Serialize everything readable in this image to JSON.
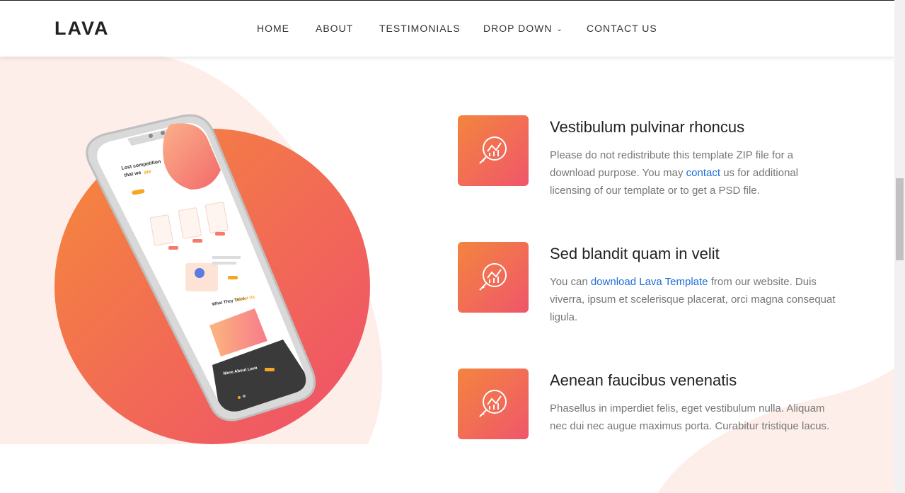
{
  "header": {
    "logo": "LAVA",
    "nav": [
      {
        "label": "HOME"
      },
      {
        "label": "ABOUT"
      },
      {
        "label": "TESTIMONIALS"
      },
      {
        "label": "DROP DOWN"
      },
      {
        "label": "CONTACT US"
      }
    ],
    "dropdown_icon": "chevron-down-icon"
  },
  "phone_screen": {
    "heading_line1": "Lost competition",
    "heading_line2": "that we",
    "heading_accent": "ate",
    "section_title": "What They Think",
    "section_accent": "About Us",
    "footer_title": "More About Lava"
  },
  "features": [
    {
      "icon": "analytics-magnifier-icon",
      "title": "Vestibulum pulvinar rhoncus",
      "text_before": "Please do not redistribute this template ZIP file for a download purpose. You may ",
      "link": "contact",
      "text_after": " us for additional licensing of our template or to get a PSD file."
    },
    {
      "icon": "analytics-magnifier-icon",
      "title": "Sed blandit quam in velit",
      "text_before": "You can ",
      "link": "download Lava Template",
      "text_after": " from our website. Duis viverra, ipsum et scelerisque placerat, orci magna consequat ligula."
    },
    {
      "icon": "analytics-magnifier-icon",
      "title": "Aenean faucibus venenatis",
      "text_before": "Phasellus in imperdiet felis, eget vestibulum nulla. Aliquam nec dui nec augue maximus porta. Curabitur tristique lacus.",
      "link": "",
      "text_after": ""
    }
  ],
  "colors": {
    "accent_start": "#f3853e",
    "accent_end": "#f0566b",
    "link": "#1e6fd9",
    "background_blob": "#fdeeea"
  }
}
